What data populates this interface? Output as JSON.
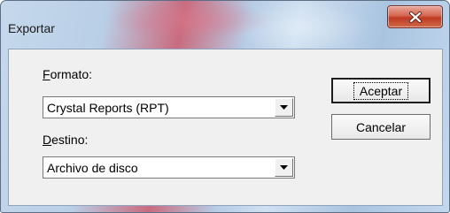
{
  "window": {
    "title": "Exportar"
  },
  "form": {
    "formato": {
      "label_access": "F",
      "label_rest": "ormato:",
      "value": "Crystal Reports (RPT)"
    },
    "destino": {
      "label_access": "D",
      "label_rest": "estino:",
      "value": "Archivo de disco"
    }
  },
  "buttons": {
    "accept": "Aceptar",
    "cancel": "Cancelar"
  },
  "icons": {
    "close": "close-icon",
    "dropdown": "chevron-down-icon"
  }
}
